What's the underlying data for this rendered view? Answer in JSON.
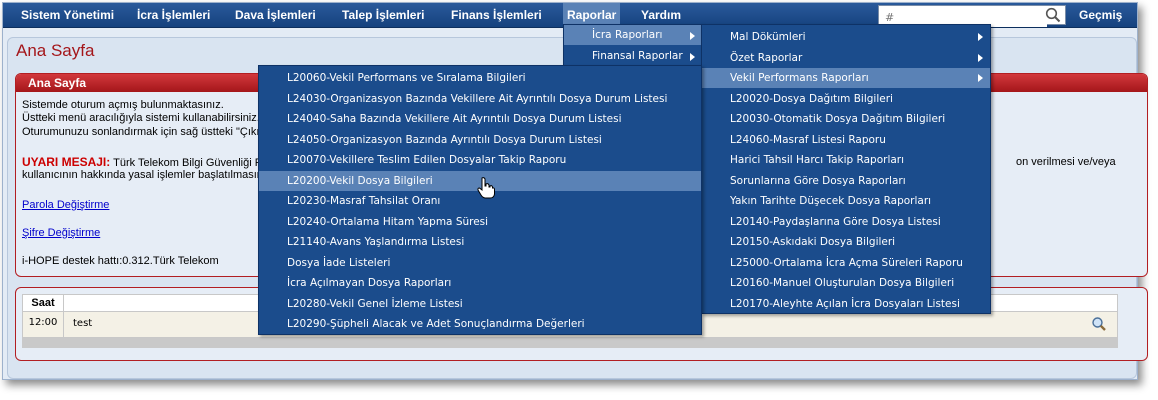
{
  "menu": {
    "items": [
      "Sistem Yönetimi",
      "İcra İşlemleri",
      "Dava İşlemleri",
      "Talep İşlemleri",
      "Finans İşlemleri",
      "Raporlar",
      "Yardım"
    ],
    "active": "Raporlar",
    "search_placeholder": "#",
    "history_label": "Geçmiş"
  },
  "page": {
    "title": "Ana Sayfa",
    "box_title": "Ana Sayfa",
    "line1": "Sistemde oturum açmış bulunmaktasınız.",
    "line2": "Üstteki menü aracılığıyla sistemi kullanabilirsiniz.",
    "line3": "Oturumunuzu sonlandırmak için sağ üstteki \"Çıkış",
    "warning_label": "UYARI MESAJI:",
    "warning_text": " Türk Telekom Bilgi Güvenliği Pol",
    "warning_text_right": "on verilmesi ve/veya",
    "warning_line2": "kullanıcının hakkında yasal işlemler başlatılmasına",
    "link_parola": "Parola Değiştirme",
    "link_sifre": "Şifre Değiştirme",
    "support": "i-HOPE destek hattı:0.312.Türk Telekom"
  },
  "table": {
    "header_saat": "Saat",
    "rows": [
      {
        "time": "12:00",
        "message": "test"
      }
    ]
  },
  "submenu_raporlar": [
    "İcra Raporları",
    "Finansal Raporlar"
  ],
  "submenu_icra": [
    "Mal Dökümleri",
    "Özet Raporlar",
    "Vekil Performans Raporları",
    "L20020-Dosya Dağıtım Bilgileri",
    "L20030-Otomatik Dosya Dağıtım Bilgileri",
    "L24060-Masraf Listesi Raporu",
    "Harici Tahsil Harcı Takip Raporları",
    "Sorunlarına Göre Dosya Raporları",
    "Yakın Tarihte Düşecek Dosya Raporları",
    "L20140-Paydaşlarına Göre Dosya Listesi",
    "L20150-Askıdaki Dosya Bilgileri",
    "L25000-Ortalama İcra Açma Süreleri Raporu",
    "L20160-Manuel Oluşturulan Dosya Bilgileri",
    "L20170-Aleyhte Açılan İcra Dosyaları Listesi"
  ],
  "submenu_vekil": [
    "L20060-Vekil Performans ve Sıralama Bilgileri",
    "L24030-Organizasyon Bazında Vekillere Ait Ayrıntılı Dosya Durum Listesi",
    "L24040-Saha Bazında Vekillere Ait Ayrıntılı Dosya Durum Listesi",
    "L24050-Organizasyon Bazında Ayrıntılı Dosya Durum Listesi",
    "L20070-Vekillere Teslim Edilen Dosyalar Takip Raporu",
    "L20200-Vekil Dosya Bilgileri",
    "L20230-Masraf Tahsilat Oranı",
    "L20240-Ortalama Hitam Yapma Süresi",
    "L21140-Avans Yaşlandırma Listesi",
    "Dosya İade Listeleri",
    "İcra Açılmayan Dosya Raporları",
    "L20280-Vekil Genel İzleme Listesi",
    "L20290-Şüpheli Alacak ve Adet Sonuçlandırma Değerleri"
  ]
}
